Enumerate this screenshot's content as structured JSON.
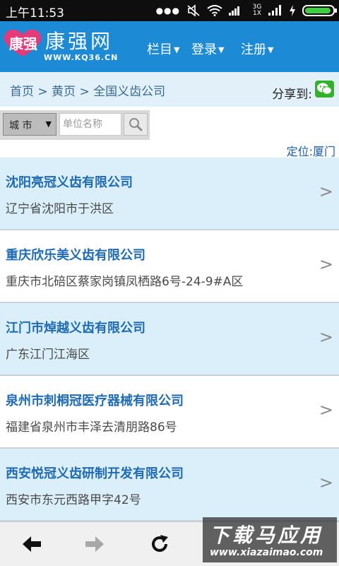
{
  "status_bar": {
    "time": "上午11:53",
    "network_label": "3G 1X",
    "icons": [
      "more-dots-icon",
      "mute-icon",
      "wifi-icon",
      "network-3g-icon",
      "signal-icon",
      "charging-icon",
      "battery-icon"
    ]
  },
  "header": {
    "logo_mark": "康强",
    "logo_name": "康强网",
    "logo_url": "WWW.KQ36.CN",
    "nav": [
      {
        "label": "栏目"
      },
      {
        "label": "登录"
      },
      {
        "label": "注册"
      }
    ],
    "brand_color": "#1d8ad6",
    "logo_mark_color": "#e5397a"
  },
  "breadcrumb": {
    "text": "首页 > 黄页 > 全国义齿公司",
    "share_label": "分享到:",
    "share_icon": "wechat-icon"
  },
  "search": {
    "city_label": "城 市",
    "unit_placeholder": "单位名称",
    "search_icon": "search-icon"
  },
  "location": {
    "text": "定位:厦门"
  },
  "companies": [
    {
      "name": "沈阳亮冠义齿有限公司",
      "address": "辽宁省沈阳市于洪区"
    },
    {
      "name": "重庆欣乐美义齿有限公司",
      "address": "重庆市北碚区蔡家岗镇凤栖路6号-24-9#A区"
    },
    {
      "name": "江门市焯越义齿有限公司",
      "address": "广东江门江海区"
    },
    {
      "name": "泉州市刺桐冠医疗器械有限公司",
      "address": "福建省泉州市丰泽去清朋路86号"
    },
    {
      "name": "西安悦冠义齿研制开发有限公司",
      "address": "西安市东元西路甲字42号"
    }
  ],
  "chevron": ">",
  "toolbar": {
    "icons": [
      "back-arrow-icon",
      "forward-arrow-icon",
      "refresh-icon"
    ]
  },
  "watermark": {
    "title": "下载马应用",
    "url": "www.xiazaimao.com"
  }
}
